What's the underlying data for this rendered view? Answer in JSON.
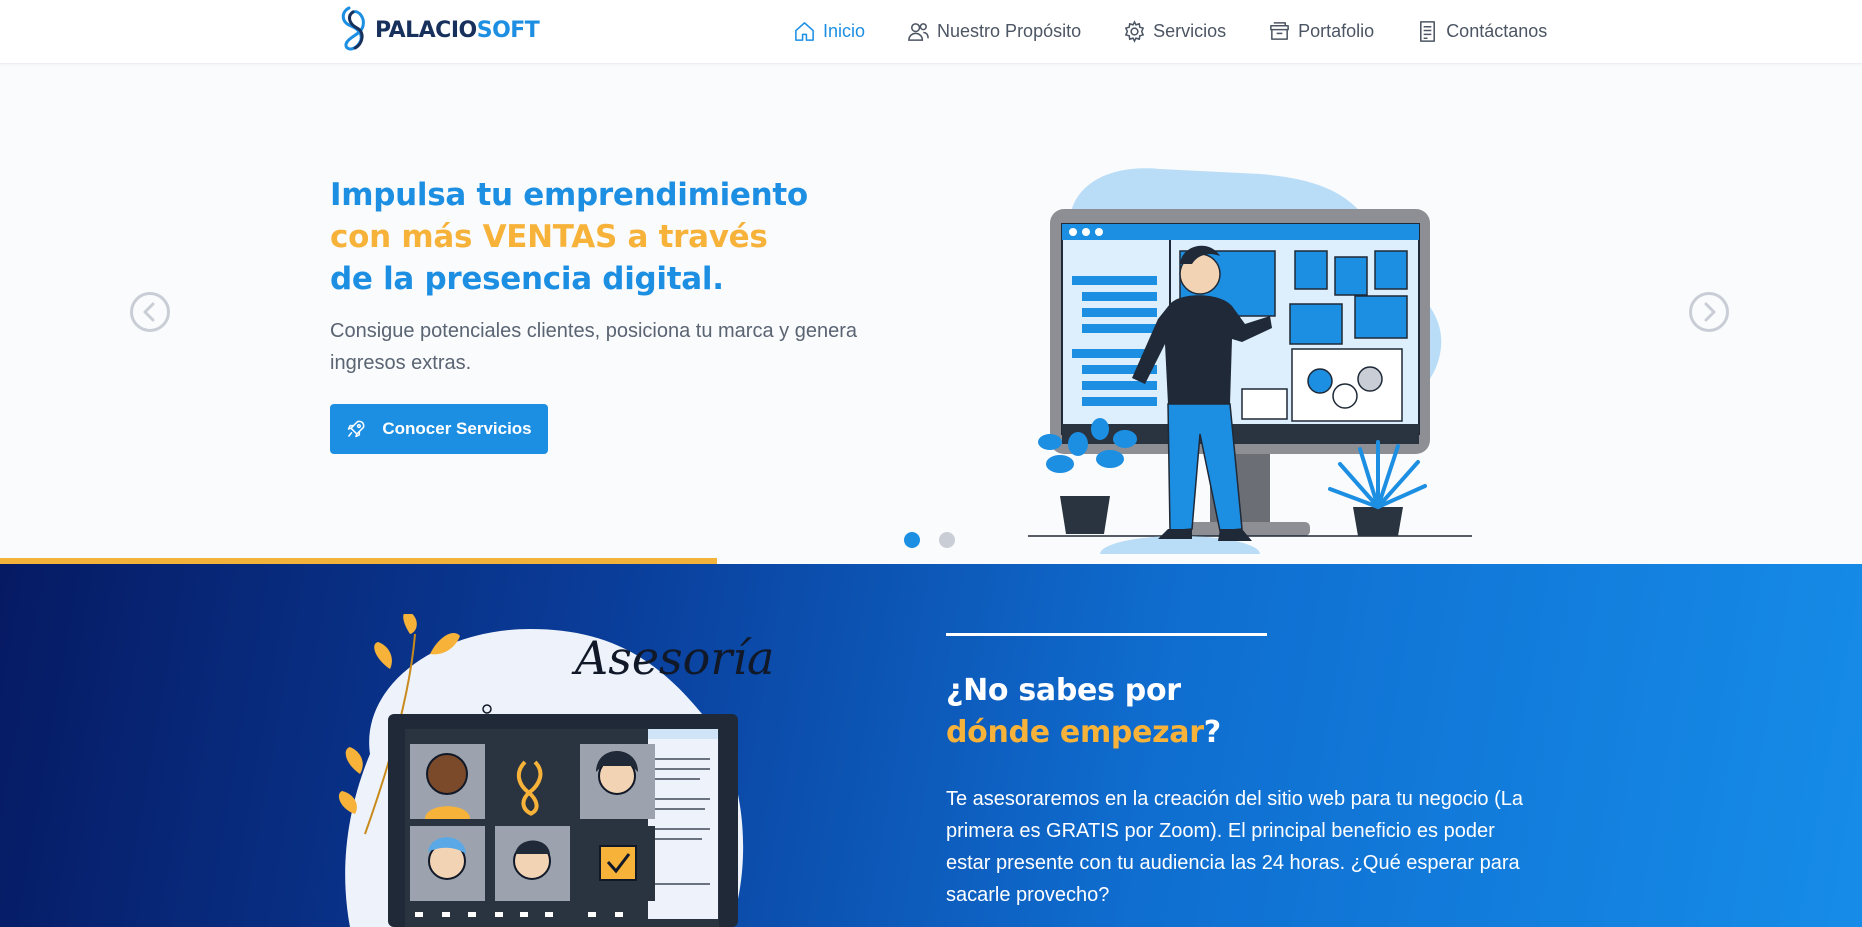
{
  "brand": {
    "name_part1": "PALACIO",
    "name_part2": "SOFT"
  },
  "nav": {
    "items": [
      {
        "label": "Inicio",
        "icon": "home-icon",
        "active": true
      },
      {
        "label": "Nuestro Propósito",
        "icon": "users-icon",
        "active": false
      },
      {
        "label": "Servicios",
        "icon": "gear-icon",
        "active": false
      },
      {
        "label": "Portafolio",
        "icon": "archive-icon",
        "active": false
      },
      {
        "label": "Contáctanos",
        "icon": "document-icon",
        "active": false
      }
    ]
  },
  "hero": {
    "title_line1": "Impulsa tu emprendimiento",
    "title_line2": "con más VENTAS a través",
    "title_line3": "de la presencia digital.",
    "subtitle": "Consigue potenciales clientes, posiciona tu marca y genera ingresos extras.",
    "button_label": "Conocer Servicios",
    "button_icon": "rocket-icon",
    "slides_count": 2,
    "active_slide": 1,
    "slide_progress": 0.385
  },
  "advice": {
    "illustration_word": "Asesoría",
    "title_line1": "¿No sabes por",
    "title_line2_highlight": "dónde empezar",
    "title_line2_suffix": "?",
    "text": "Te asesoraremos en la creación del sitio web para tu negocio (La primera es GRATIS por Zoom). El principal beneficio es poder estar presente con tu audiencia las 24 horas. ¿Qué esperar para sacarle provecho?"
  },
  "colors": {
    "primary": "#1d8fe3",
    "accent": "#f7b23a",
    "navy": "#17305c",
    "text_gray": "#5a6472"
  }
}
